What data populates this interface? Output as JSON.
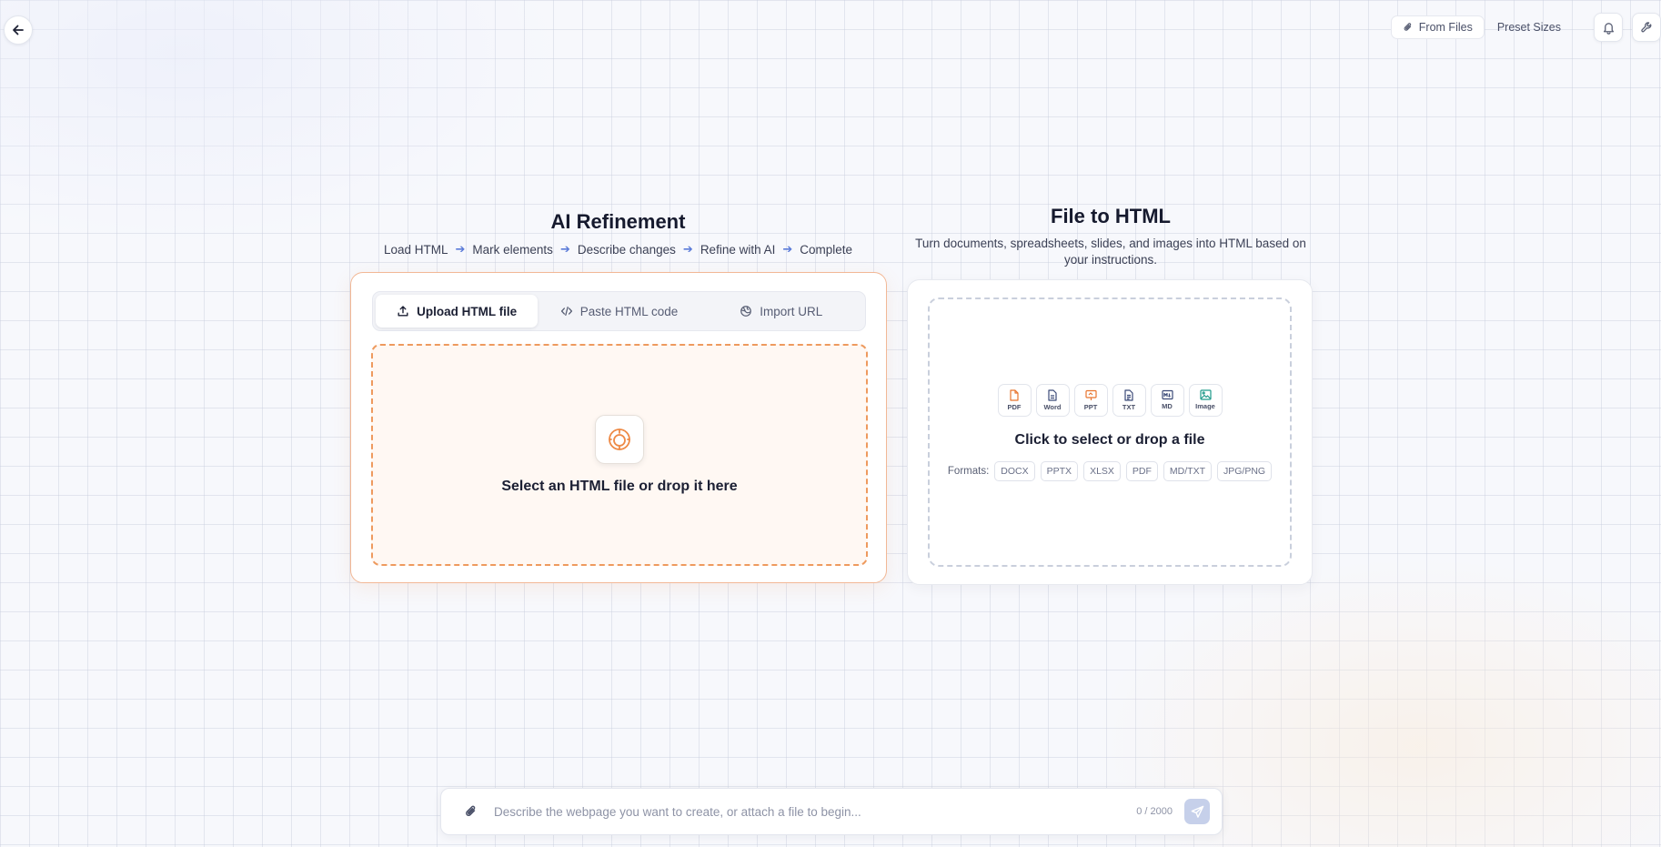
{
  "topbar": {
    "from_files": "From Files",
    "preset_sizes": "Preset Sizes"
  },
  "refine": {
    "title": "AI Refinement",
    "steps": [
      "Load HTML",
      "Mark elements",
      "Describe changes",
      "Refine with AI",
      "Complete"
    ],
    "tabs": [
      {
        "label": "Upload HTML file",
        "icon": "upload-icon"
      },
      {
        "label": "Paste HTML code",
        "icon": "code-icon"
      },
      {
        "label": "Import URL",
        "icon": "globe-icon"
      }
    ],
    "dropzone_text": "Select an HTML file or drop it here"
  },
  "file_to_html": {
    "title": "File to HTML",
    "subtitle": "Turn documents, spreadsheets, slides, and images into HTML based on your instructions.",
    "types": [
      {
        "label": "PDF",
        "color": "#e8742f"
      },
      {
        "label": "Word",
        "color": "#3b4a78"
      },
      {
        "label": "PPT",
        "color": "#e8742f"
      },
      {
        "label": "TXT",
        "color": "#3b4a78"
      },
      {
        "label": "MD",
        "color": "#3b4a78"
      },
      {
        "label": "Image",
        "color": "#1f9a8a"
      }
    ],
    "dropzone_text": "Click to select or drop a file",
    "formats_label": "Formats:",
    "formats": [
      "DOCX",
      "PPTX",
      "XLSX",
      "PDF",
      "MD/TXT",
      "JPG/PNG"
    ]
  },
  "chat": {
    "placeholder": "Describe the webpage you want to create, or attach a file to begin...",
    "counter": "0 / 2000"
  },
  "colors": {
    "accent": "#ee9a5e",
    "send_disabled": "#c6d0ea"
  }
}
